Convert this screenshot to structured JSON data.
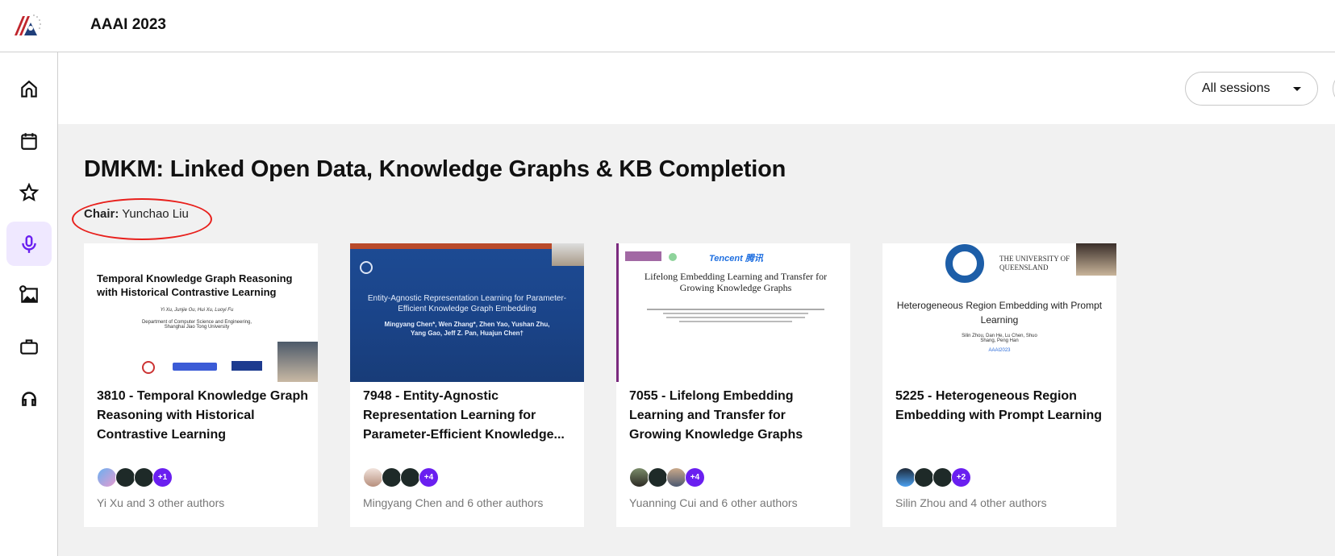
{
  "header": {
    "app_title": "AAAI 2023"
  },
  "sidebar": {
    "items": [
      {
        "name": "home",
        "icon": "home-icon"
      },
      {
        "name": "calendar",
        "icon": "calendar-icon"
      },
      {
        "name": "favorites",
        "icon": "star-icon"
      },
      {
        "name": "sessions",
        "icon": "microphone-icon",
        "active": true
      },
      {
        "name": "posters",
        "icon": "image-icon"
      },
      {
        "name": "sponsors",
        "icon": "briefcase-icon"
      },
      {
        "name": "support",
        "icon": "headphones-icon"
      }
    ]
  },
  "filters": {
    "session_select": "All sessions"
  },
  "session": {
    "title": "DMKM: Linked Open Data, Knowledge Graphs & KB Completion",
    "chair_label": "Chair:",
    "chair_name": "Yunchao Liu"
  },
  "colors": {
    "accent": "#6a1ff0",
    "active_bg": "#efe8ff",
    "annotation": "#e8201c"
  },
  "cards": [
    {
      "title": "3810 - Temporal Knowledge Graph Reasoning with Historical Contrastive Learning",
      "slide_title": "Temporal Knowledge Graph Reasoning with Historical Contrastive Learning",
      "slide_authors": "Yi Xu, Junjie Ou, Hui Xu, Luoyi Fu",
      "slide_affil": "Department of Computer Science and Engineering, Shanghai Jiao Tong University",
      "more": "+1",
      "authors": "Yi Xu and 3 other authors"
    },
    {
      "title": "7948 - Entity-Agnostic Representation Learning for Parameter-Efficient Knowledge...",
      "slide_title": "Entity-Agnostic Representation Learning for Parameter-Efficient Knowledge Graph Embedding",
      "slide_authors": "Mingyang Chen*, Wen Zhang*, Zhen Yao, Yushan Zhu, Yang Gao, Jeff Z. Pan, Huajun Chen†",
      "more": "+4",
      "authors": "Mingyang Chen and 6 other authors"
    },
    {
      "title": "7055 - Lifelong Embedding Learning and Transfer for Growing Knowledge Graphs",
      "slide_title": "Lifelong Embedding Learning and Transfer for Growing Knowledge Graphs",
      "slide_brand": "Tencent 腾讯",
      "more": "+4",
      "authors": "Yuanning Cui and 6 other authors"
    },
    {
      "title": "5225 - Heterogeneous Region Embedding with Prompt Learning",
      "slide_title": "Heterogeneous Region Embedding with Prompt Learning",
      "slide_authors": "Silin Zhou, Dan He, Lu Chen, Shuo Shang, Peng Han",
      "slide_venue": "AAAI2023",
      "slide_uni": "THE UNIVERSITY OF QUEENSLAND",
      "more": "+2",
      "authors": "Silin Zhou and 4 other authors"
    }
  ]
}
